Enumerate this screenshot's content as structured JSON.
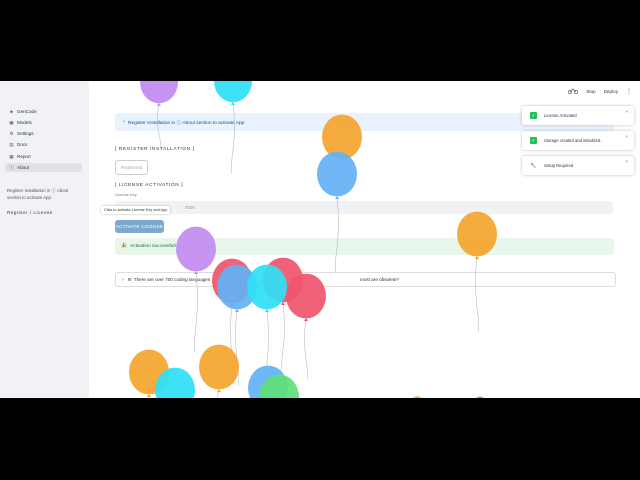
{
  "sidebar": {
    "items": [
      {
        "label": "GenCode",
        "icon": "code-icon",
        "active": false
      },
      {
        "label": "Models",
        "icon": "cube-icon",
        "active": false
      },
      {
        "label": "Settings",
        "icon": "gear-icon",
        "active": false
      },
      {
        "label": "Docs",
        "icon": "doc-icon",
        "active": false
      },
      {
        "label": "Report",
        "icon": "report-icon",
        "active": false
      },
      {
        "label": "About",
        "icon": "info-icon",
        "active": true
      }
    ],
    "note": "Register Installation in ⓘ About section to activate App.",
    "register_license": "Register / License"
  },
  "topbar": {
    "stop": "Stop",
    "deploy": "Deploy",
    "menu": "⋮"
  },
  "main": {
    "info_text": "Register Installation in ⓘ About section to activate App",
    "register_header": "[ REGISTER INSTALLATION ]",
    "registered_label": "Registered",
    "license_header": "[ LICENSE ACTIVATION ]",
    "license_key_label": "License Key",
    "license_key_value": "0000",
    "tooltip": "Click to activate License Key and App",
    "activate_label": "ACTIVATE LICENSE",
    "success_text": "Activation successful!",
    "expander_text": "There are over 700 coding languages",
    "expander_text_end": "most are obsolete?"
  },
  "toasts": [
    {
      "text": "License Activated",
      "type": "ok"
    },
    {
      "text": "Storage created and initialized.",
      "type": "ok"
    },
    {
      "text": "Setup Required",
      "type": "wrench"
    }
  ],
  "balloon_colors": {
    "purple": "#c18af0",
    "cyan": "#2ee0f5",
    "orange": "#f5a42c",
    "blue": "#63b1f5",
    "red": "#f0556e",
    "green": "#5ee07a"
  }
}
